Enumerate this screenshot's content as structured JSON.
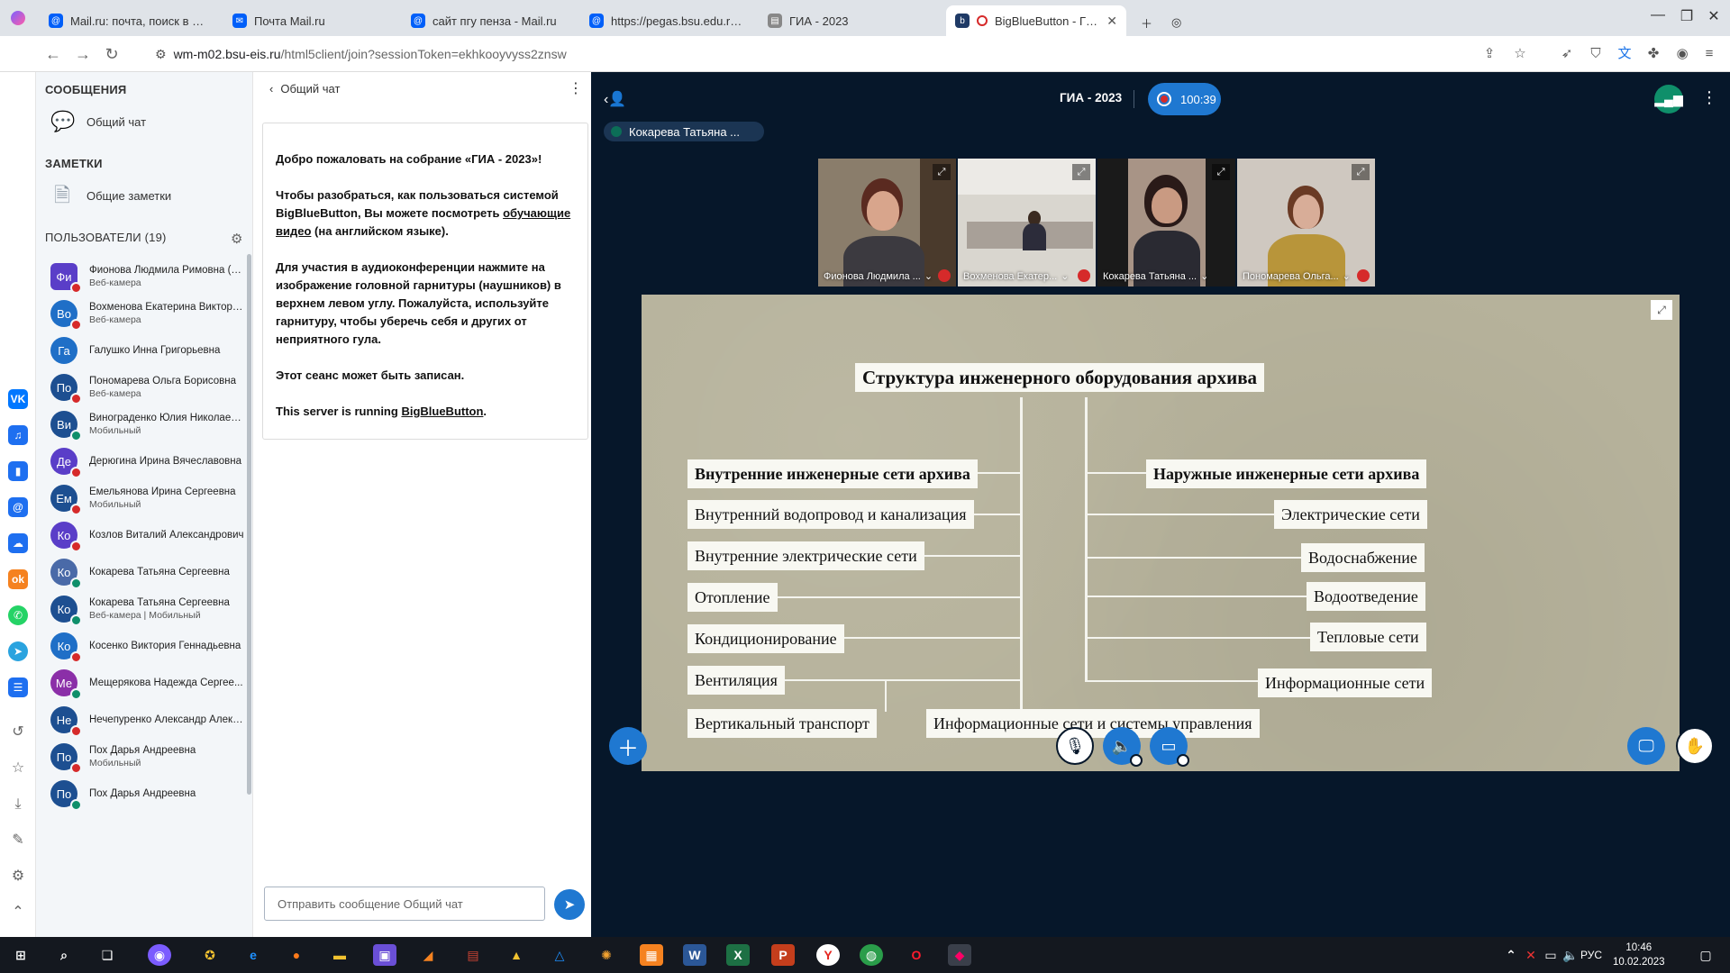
{
  "browser": {
    "tabs": [
      {
        "title": "Mail.ru: почта, поиск в интер",
        "icon": "mailru-icon",
        "color": "#005ff9"
      },
      {
        "title": "Почта Mail.ru",
        "icon": "mail-envelope-icon",
        "color": "#005ff9"
      },
      {
        "title": "сайт пгу пенза - Mail.ru",
        "icon": "mailru-icon",
        "color": "#005ff9"
      },
      {
        "title": "https://pegas.bsu.edu.ru/mc",
        "icon": "mailru-icon",
        "color": "#005ff9"
      },
      {
        "title": "ГИА - 2023",
        "icon": "document-icon",
        "color": "#888888"
      },
      {
        "title": "BigBlueButton - ГИА - D",
        "icon": "bbb-icon",
        "color": "#1f3a66"
      }
    ],
    "url_host": "wm-m02.bsu-eis.ru",
    "url_path": "/html5client/join?sessionToken=ekhkooyvyss2znsw"
  },
  "sidebar": {
    "messages_header": "СООБЩЕНИЯ",
    "public_chat": "Общий чат",
    "notes_header": "ЗАМЕТКИ",
    "shared_notes": "Общие заметки",
    "users_header": "ПОЛЬЗОВАТЕЛИ (19)"
  },
  "users": [
    {
      "initials": "Фи",
      "name": "Фионова Людмила Римовна (Вы)",
      "sub": "Веб-камера",
      "color": "#5a3ec8",
      "status": "#d62a2a",
      "shape": "square"
    },
    {
      "initials": "Во",
      "name": "Вохменова Екатерина Викторо...",
      "sub": "Веб-камера",
      "color": "#1f6fc7",
      "status": "#d62a2a",
      "shape": "circle"
    },
    {
      "initials": "Га",
      "name": "Галушко Инна Григорьевна",
      "sub": "",
      "color": "#1f6fc7",
      "status": "",
      "shape": "circle"
    },
    {
      "initials": "По",
      "name": "Пономарева Ольга Борисовна",
      "sub": "Веб-камера",
      "color": "#1d4f91",
      "status": "#d62a2a",
      "shape": "circle"
    },
    {
      "initials": "Ви",
      "name": "Винограденко Юлия Николаев...",
      "sub": "Мобильный",
      "color": "#1d4f91",
      "status": "#0f8f6a",
      "shape": "circle"
    },
    {
      "initials": "Де",
      "name": "Дерюгина Ирина Вячеславовна",
      "sub": "",
      "color": "#5a3ec8",
      "status": "#d62a2a",
      "shape": "circle"
    },
    {
      "initials": "Ем",
      "name": "Емельянова Ирина Сергеевна",
      "sub": "Мобильный",
      "color": "#1d4f91",
      "status": "#d62a2a",
      "shape": "circle"
    },
    {
      "initials": "Ко",
      "name": "Козлов Виталий Александрович",
      "sub": "",
      "color": "#5a3ec8",
      "status": "#d62a2a",
      "shape": "circle"
    },
    {
      "initials": "Ко",
      "name": "Кокарева Татьяна Сергеевна",
      "sub": "",
      "color": "#4a6aa8",
      "status": "#0f8f6a",
      "shape": "circle"
    },
    {
      "initials": "Ко",
      "name": "Кокарева Татьяна Сергеевна",
      "sub": "Веб-камера | Мобильный",
      "color": "#1d4f91",
      "status": "#0f8f6a",
      "shape": "circle"
    },
    {
      "initials": "Ко",
      "name": "Косенко Виктория Геннадьевна",
      "sub": "",
      "color": "#1f6fc7",
      "status": "#d62a2a",
      "shape": "circle"
    },
    {
      "initials": "Ме",
      "name": "Мещерякова Надежда Сергее...",
      "sub": "",
      "color": "#8b2fa8",
      "status": "#0f8f6a",
      "shape": "circle"
    },
    {
      "initials": "Не",
      "name": "Нечепуренко Александр Алекс...",
      "sub": "",
      "color": "#1d4f91",
      "status": "#d62a2a",
      "shape": "circle"
    },
    {
      "initials": "По",
      "name": "Пох Дарья Андреевна",
      "sub": "Мобильный",
      "color": "#1d4f91",
      "status": "#d62a2a",
      "shape": "circle"
    },
    {
      "initials": "По",
      "name": "Пох Дарья Андреевна",
      "sub": "",
      "color": "#1d4f91",
      "status": "#0f8f6a",
      "shape": "circle"
    }
  ],
  "chat": {
    "header": "Общий чат",
    "welcome_p1_pre": "Добро пожаловать на собрание «",
    "welcome_p1_name": "ГИА - 2023",
    "welcome_p1_post": "»!",
    "welcome_p2_a": "Чтобы разобраться, как пользоваться системой BigBlueButton, Вы можете посмотреть ",
    "welcome_p2_link": "обучающие видео",
    "welcome_p2_b": " (на английском языке).",
    "welcome_p3_a": "Для участия в аудиоконференции нажмите на изображение головной гарнитуры (наушников) в верхнем левом углу. ",
    "welcome_p3_b": "Пожалуйста, используйте гарнитуру, чтобы уберечь себя и других от неприятного гула.",
    "welcome_p4": "Этот сеанс может быть записан.",
    "welcome_p5_a": "This server is running ",
    "welcome_p5_link": "BigBlueButton",
    "welcome_p5_b": ".",
    "input_placeholder": "Отправить сообщение Общий чат"
  },
  "meeting": {
    "title": "ГИА - 2023",
    "timer": "100:39",
    "talker": "Кокарева Татьяна ..."
  },
  "videos": [
    {
      "name": "Фионова Людмила ...",
      "bg": "#8a7d6b"
    },
    {
      "name": "Вохменова Екатер...",
      "bg": "#d9d6cf"
    },
    {
      "name": "Кокарева Татьяна ...",
      "bg": "#a89486"
    },
    {
      "name": "Пономарева Ольга...",
      "bg": "#cfc8c0"
    }
  ],
  "slide": {
    "title": "Структура инженерного оборудования архива",
    "left_header": "Внутренние инженерные сети архива",
    "left_items": [
      "Внутренний водопровод и канализация",
      "Внутренние электрические сети",
      "Отопление",
      "Кондиционирование",
      "Вентиляция",
      "Вертикальный транспорт"
    ],
    "right_header": "Наружные инженерные сети архива",
    "right_items": [
      "Электрические сети",
      "Водоснабжение",
      "Водоотведение",
      "Тепловые сети",
      "Информационные сети"
    ],
    "bottom_item": "Информационные сети и системы управления"
  },
  "taskbar": {
    "lang": "РУС",
    "time": "10:46",
    "date": "10.02.2023"
  }
}
